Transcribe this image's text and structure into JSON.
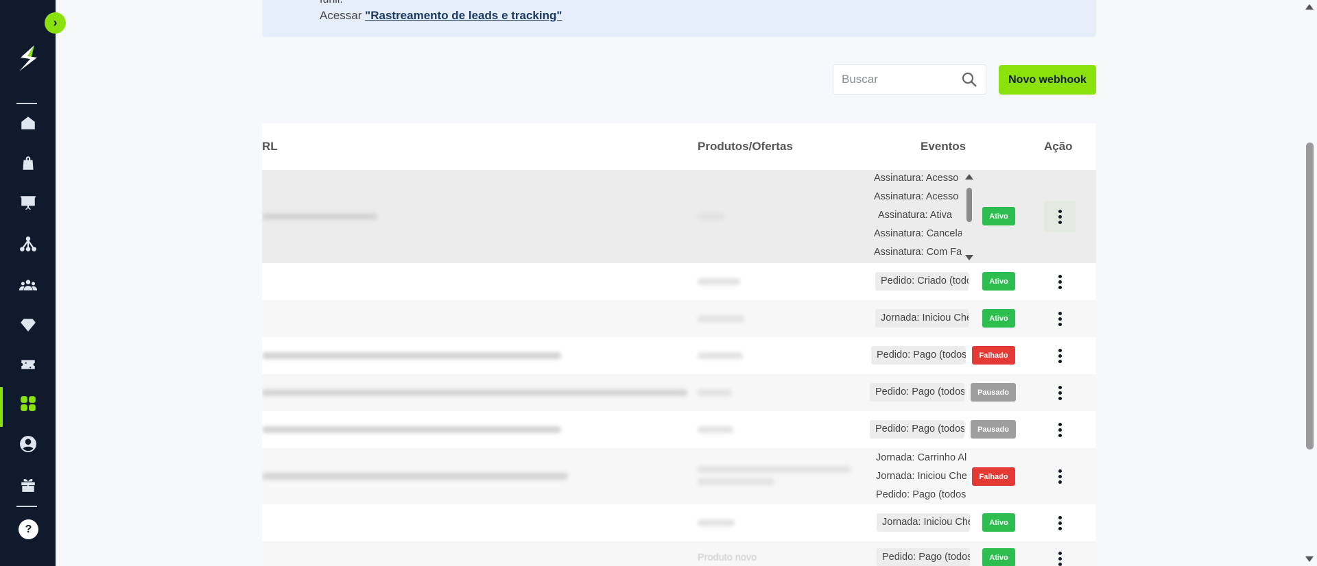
{
  "sidebar": {
    "toggle_icon": "chevron-right-icon",
    "items": [
      {
        "name": "home",
        "icon": "home-icon"
      },
      {
        "name": "products",
        "icon": "shopping-bag-icon"
      },
      {
        "name": "dashboard",
        "icon": "presentation-chart-icon"
      },
      {
        "name": "affiliates",
        "icon": "network-icon"
      },
      {
        "name": "customers",
        "icon": "users-icon"
      },
      {
        "name": "members",
        "icon": "diamond-icon"
      },
      {
        "name": "sales",
        "icon": "ticket-icon"
      },
      {
        "name": "apps",
        "icon": "apps-grid-icon",
        "active": true
      },
      {
        "name": "profile",
        "icon": "user-circle-icon"
      },
      {
        "name": "rewards",
        "icon": "gift-icon"
      }
    ],
    "help_label": "?"
  },
  "banner": {
    "cut_text": "funil.",
    "prefix": "Acessar",
    "link": "\"Rastreamento de leads e tracking\""
  },
  "toolbar": {
    "search_placeholder": "Buscar",
    "new_button": "Novo webhook"
  },
  "table": {
    "headers": {
      "url": "RL",
      "products": "Produtos/Ofertas",
      "events": "Eventos",
      "action": "Ação"
    },
    "rows": [
      {
        "events": [
          "Assinatura: Acesso L",
          "Assinatura: Acesso F",
          "Assinatura: Ativa",
          "Assinatura: Cancelac",
          "Assinatura: Com Fall"
        ],
        "status": "Ativo",
        "status_color": "#2dbe4f"
      },
      {
        "events": [
          "Pedido: Criado (todos"
        ],
        "status": "Ativo",
        "status_color": "#2dbe4f"
      },
      {
        "events": [
          "Jornada: Iniciou Che"
        ],
        "status": "Ativo",
        "status_color": "#2dbe4f"
      },
      {
        "events": [
          "Pedido: Pago (todos"
        ],
        "status": "Falhado",
        "status_color": "#e53935"
      },
      {
        "events": [
          "Pedido: Pago (todos"
        ],
        "status": "Pausado",
        "status_color": "#9e9e9e"
      },
      {
        "events": [
          "Pedido: Pago (todos"
        ],
        "status": "Pausado",
        "status_color": "#9e9e9e"
      },
      {
        "events": [
          "Jornada: Carrinho Al",
          "Jornada: Iniciou Che",
          "Pedido: Pago (todos"
        ],
        "status": "Falhado",
        "status_color": "#e53935"
      },
      {
        "events": [
          "Jornada: Iniciou Che"
        ],
        "status": "Ativo",
        "status_color": "#2dbe4f"
      },
      {
        "products": "Produto novo",
        "events": [
          "Pedido: Pago (todos"
        ],
        "status": "Ativo",
        "status_color": "#2dbe4f"
      }
    ]
  },
  "colors": {
    "accent": "#8be10c",
    "sidebar": "#0f1b2d"
  }
}
